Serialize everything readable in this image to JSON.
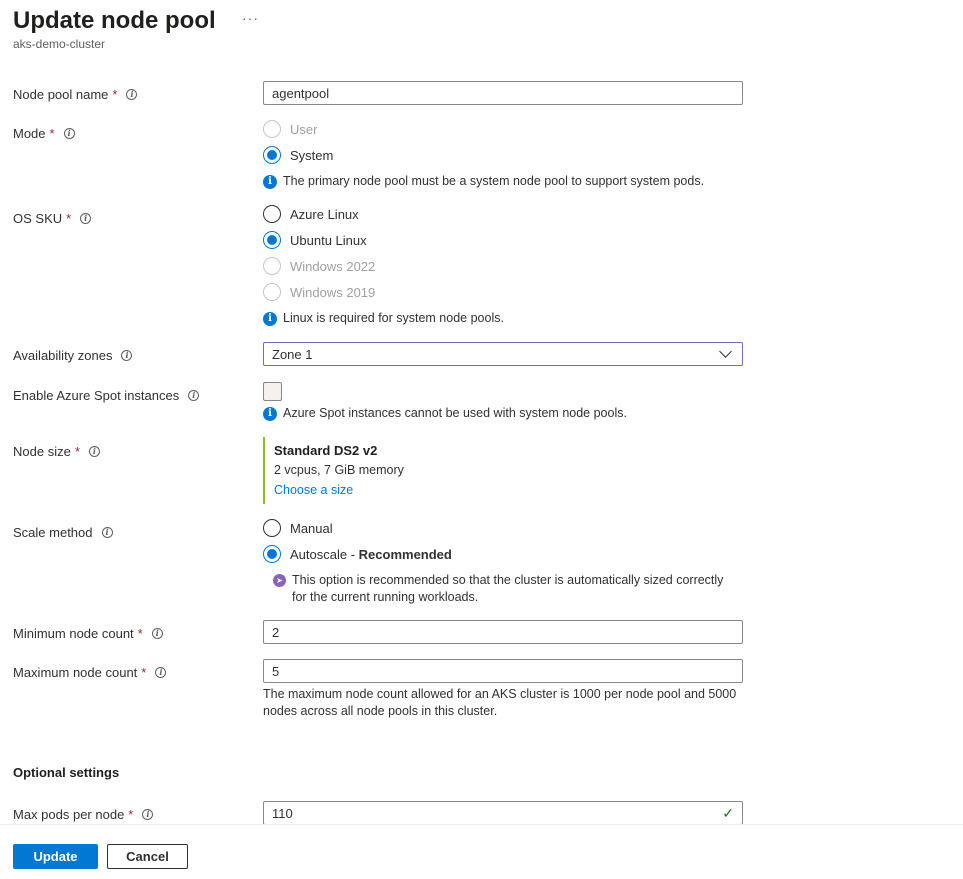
{
  "header": {
    "title": "Update node pool",
    "more": "···",
    "subtitle": "aks-demo-cluster"
  },
  "node_pool_name": {
    "label": "Node pool name",
    "required": "*",
    "value": "agentpool"
  },
  "mode": {
    "label": "Mode",
    "required": "*",
    "options": [
      {
        "label": "User",
        "state": "disabled"
      },
      {
        "label": "System",
        "state": "checked"
      }
    ],
    "info": "The primary node pool must be a system node pool to support system pods."
  },
  "os_sku": {
    "label": "OS SKU",
    "required": "*",
    "options": [
      {
        "label": "Azure Linux",
        "state": "unchecked"
      },
      {
        "label": "Ubuntu Linux",
        "state": "checked"
      },
      {
        "label": "Windows 2022",
        "state": "disabled"
      },
      {
        "label": "Windows 2019",
        "state": "disabled"
      }
    ],
    "info": "Linux is required for system node pools."
  },
  "availability_zones": {
    "label": "Availability zones",
    "value": "Zone 1"
  },
  "spot": {
    "label": "Enable Azure Spot instances",
    "checked": false,
    "info": "Azure Spot instances cannot be used with system node pools."
  },
  "node_size": {
    "label": "Node size",
    "required": "*",
    "name": "Standard DS2 v2",
    "spec": "2 vcpus, 7 GiB memory",
    "link": "Choose a size"
  },
  "scale_method": {
    "label": "Scale method",
    "options": [
      {
        "label": "Manual",
        "state": "unchecked"
      },
      {
        "label": "Autoscale",
        "suffix": "Recommended",
        "state": "checked"
      }
    ],
    "recommend_line1": "This option is recommended so that the cluster is automatically sized correctly",
    "recommend_line2": "for the current running workloads."
  },
  "min_count": {
    "label": "Minimum node count",
    "required": "*",
    "value": "2"
  },
  "max_count": {
    "label": "Maximum node count",
    "required": "*",
    "value": "5",
    "note": "The maximum node count allowed for an AKS cluster is 1000 per node pool and 5000 nodes across all node pools in this cluster."
  },
  "optional": {
    "heading": "Optional settings"
  },
  "max_pods": {
    "label": "Max pods per node",
    "required": "*",
    "value": "110"
  },
  "footer": {
    "update": "Update",
    "cancel": "Cancel"
  },
  "colors": {
    "accent": "#0078d4",
    "required": "#a4262c",
    "valid": "#107c10",
    "size_bar": "#8cbd18"
  }
}
